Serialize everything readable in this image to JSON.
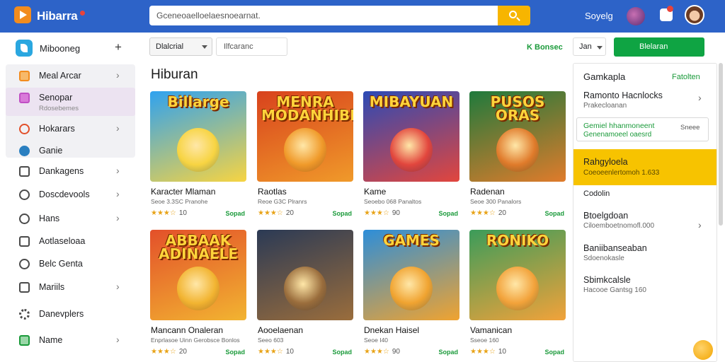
{
  "header": {
    "brand": "Hibarra",
    "search_placeholder": "Gceneoaelloelaesnoearnat.",
    "user_name": "Soyelg"
  },
  "sidebar": {
    "head_label": "Mibooneg",
    "items": [
      {
        "label": "Meal Arcar",
        "sub": ""
      },
      {
        "label": "Senopar",
        "sub": "Rdosebemes"
      },
      {
        "label": "Hokarars",
        "sub": ""
      },
      {
        "label": "Ganie",
        "sub": ""
      },
      {
        "label": "Dankagens",
        "sub": ""
      },
      {
        "label": "Doscdevools",
        "sub": ""
      },
      {
        "label": "Hans",
        "sub": ""
      },
      {
        "label": "Aotlaseloaa",
        "sub": ""
      },
      {
        "label": "Belc Genta",
        "sub": ""
      },
      {
        "label": "Mariils",
        "sub": ""
      },
      {
        "label": "Danevplers",
        "sub": ""
      },
      {
        "label": "Name",
        "sub": ""
      }
    ]
  },
  "filters": {
    "category": "Dlalcrial",
    "search_value": "Ilfcaranc",
    "green_link": "K Bonsec",
    "sort": "Jan",
    "action_button": "Blelaran"
  },
  "section_title": "Hiburan",
  "cards": [
    {
      "thumb": "Billarge",
      "title": "Karacter Mlaman",
      "sub": "Seoe 3.3SC Pranohe",
      "stars": "★★★☆",
      "rating": "10",
      "badge": "Sopad",
      "bg1": "#2fa2f0",
      "bg2": "#f7d442"
    },
    {
      "thumb": "MENRA MODANHIBB",
      "title": "Raotlas",
      "sub": "Reoe G3C Plranrs",
      "stars": "★★★☆",
      "rating": "20",
      "badge": "Sopad",
      "bg1": "#d8421d",
      "bg2": "#f09a2a"
    },
    {
      "thumb": "MIBAYUAN",
      "title": "Kame",
      "sub": "Seoebo 068 Panaltos",
      "stars": "★★★☆",
      "rating": "90",
      "badge": "Sopad",
      "bg1": "#2b4ab6",
      "bg2": "#e2463d"
    },
    {
      "thumb": "PUSOS ORAS",
      "title": "Radenan",
      "sub": "Seoe 300 Panalors",
      "stars": "★★★☆",
      "rating": "20",
      "badge": "Sopad",
      "bg1": "#1f7a3c",
      "bg2": "#e07b2b"
    },
    {
      "thumb": "ABBAAK ADINAELE",
      "title": "Mancann Onaleran",
      "sub": "Enprlasoe Uinn Gerobsce Bonlos",
      "stars": "★★★☆",
      "rating": "20",
      "badge": "Sopad",
      "bg1": "#e3502a",
      "bg2": "#f2b431"
    },
    {
      "thumb": "",
      "title": "Aooelaenan",
      "sub": "Seeo 603",
      "stars": "★★★☆",
      "rating": "10",
      "badge": "Sopad",
      "bg1": "#2b3a55",
      "bg2": "#9a6d3c"
    },
    {
      "thumb": "GAMES",
      "title": "Dnekan Haisel",
      "sub": "Seoe I40",
      "stars": "★★★☆",
      "rating": "90",
      "badge": "Sopad",
      "bg1": "#2d8ed9",
      "bg2": "#f0a330"
    },
    {
      "thumb": "RONIKO",
      "title": "Vamanican",
      "sub": "Sseoe 160",
      "stars": "★★★☆",
      "rating": "10",
      "badge": "Sopad",
      "bg1": "#3b9c5a",
      "bg2": "#f2a23a"
    }
  ],
  "right_panel": {
    "head": "Gamkapla",
    "head_link": "Fatolten",
    "items": [
      {
        "title": "Ramonto Hacnlocks",
        "sub": "Prakecloanan"
      },
      {
        "title": "Gemiel hhanmoneent",
        "sub": "Genenamoeel oaesrd",
        "side": "Sneee"
      },
      {
        "title": "Rahgyloela",
        "sub": "Coeoeenlertomoh 1.633"
      },
      {
        "title": "Codolin",
        "sub": ""
      },
      {
        "title": "Btoelgdoan",
        "sub": "Ciloemboetnomofl.000"
      },
      {
        "title": "Baniibanseaban",
        "sub": "Sdoenokasle"
      },
      {
        "title": "Sbimkcalsle",
        "sub": "Hacooe Gantsg 160"
      }
    ]
  },
  "colors": {
    "topbar": "#2d63c8",
    "accent_green": "#0fa443",
    "highlight": "#f7c300"
  }
}
